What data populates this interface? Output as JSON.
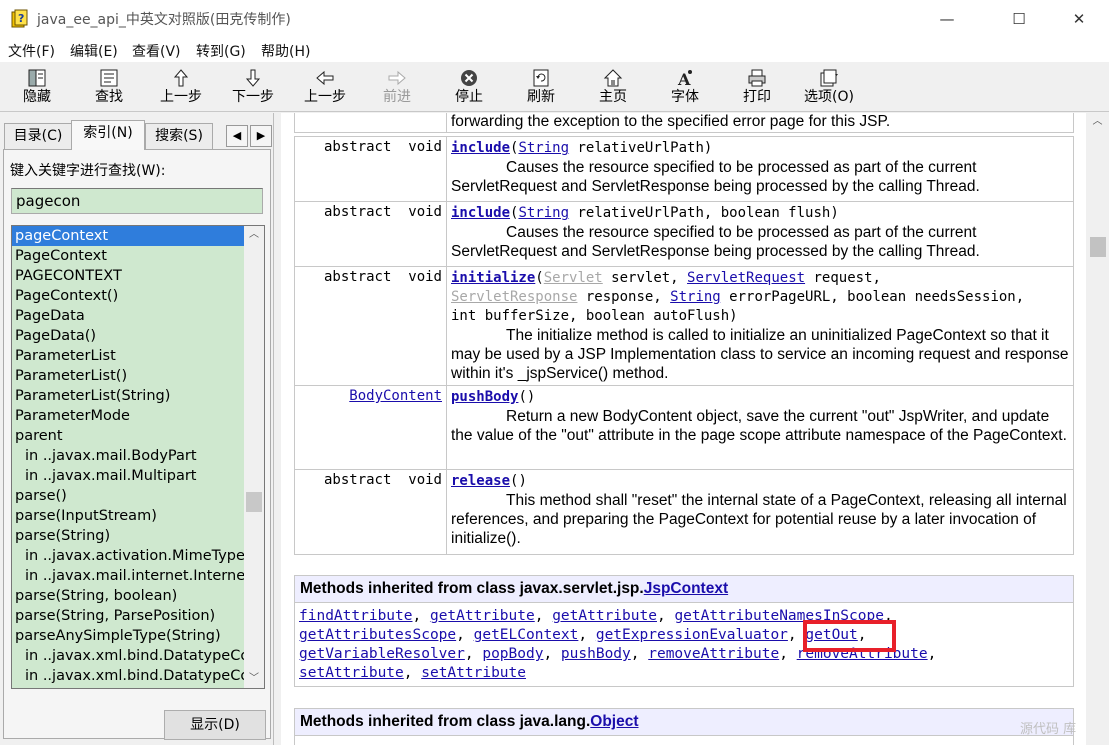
{
  "window": {
    "title": "java_ee_api_中英文对照版(田克传制作)",
    "minimize": "—",
    "maximize": "☐",
    "close": "✕"
  },
  "menu": [
    "文件(F)",
    "编辑(E)",
    "查看(V)",
    "转到(G)",
    "帮助(H)"
  ],
  "toolbar": [
    {
      "label": "隐藏",
      "icon": "hide-icon",
      "enabled": true
    },
    {
      "label": "查找",
      "icon": "find-icon",
      "enabled": true
    },
    {
      "label": "上一步",
      "icon": "up-arrow-icon",
      "enabled": true
    },
    {
      "label": "下一步",
      "icon": "down-arrow-icon",
      "enabled": true
    },
    {
      "label": "上一步",
      "icon": "back-arrow-icon",
      "enabled": true
    },
    {
      "label": "前进",
      "icon": "forward-arrow-icon",
      "enabled": false
    },
    {
      "label": "停止",
      "icon": "stop-icon",
      "enabled": true
    },
    {
      "label": "刷新",
      "icon": "refresh-icon",
      "enabled": true
    },
    {
      "label": "主页",
      "icon": "home-icon",
      "enabled": true
    },
    {
      "label": "字体",
      "icon": "font-icon",
      "enabled": true
    },
    {
      "label": "打印",
      "icon": "print-icon",
      "enabled": true
    },
    {
      "label": "选项(O)",
      "icon": "options-icon",
      "enabled": true
    }
  ],
  "tabs": [
    {
      "label": "目录(C)",
      "active": false
    },
    {
      "label": "索引(N)",
      "active": true
    },
    {
      "label": "搜索(S)",
      "active": false
    }
  ],
  "index": {
    "keyword_label": "键入关键字进行查找(W):",
    "keyword_value": "pagecon",
    "items": [
      {
        "text": "pageContext",
        "sub": false,
        "selected": true
      },
      {
        "text": "PageContext",
        "sub": false
      },
      {
        "text": "PAGECONTEXT",
        "sub": false
      },
      {
        "text": "PageContext()",
        "sub": false
      },
      {
        "text": "PageData",
        "sub": false
      },
      {
        "text": "PageData()",
        "sub": false
      },
      {
        "text": "ParameterList",
        "sub": false
      },
      {
        "text": "ParameterList()",
        "sub": false
      },
      {
        "text": "ParameterList(String)",
        "sub": false
      },
      {
        "text": "ParameterMode",
        "sub": false
      },
      {
        "text": "parent",
        "sub": false
      },
      {
        "text": "in ..javax.mail.BodyPart",
        "sub": true
      },
      {
        "text": "in ..javax.mail.Multipart",
        "sub": true
      },
      {
        "text": "parse()",
        "sub": false
      },
      {
        "text": "parse(InputStream)",
        "sub": false
      },
      {
        "text": "parse(String)",
        "sub": false
      },
      {
        "text": "in ..javax.activation.MimeType",
        "sub": true
      },
      {
        "text": "in ..javax.mail.internet.Internet",
        "sub": true
      },
      {
        "text": "parse(String, boolean)",
        "sub": false
      },
      {
        "text": "parse(String, ParsePosition)",
        "sub": false
      },
      {
        "text": "parseAnySimpleType(String)",
        "sub": false
      },
      {
        "text": "in ..javax.xml.bind.DatatypeCo",
        "sub": true
      },
      {
        "text": "in ..javax.xml.bind.DatatypeCo",
        "sub": true
      }
    ],
    "show_button": "显示(D)"
  },
  "content": {
    "top_fragment": "forwarding the exception to the specified error page for this JSP.",
    "methods": [
      {
        "type": "abstract  void",
        "name": "include",
        "sig_parts": [
          {
            "t": "(",
            "k": "text"
          },
          {
            "t": "String",
            "k": "link"
          },
          {
            "t": " relativeUrlPath)",
            "k": "text"
          }
        ],
        "desc": "Causes the resource specified to be processed as part of the current ServletRequest and ServletResponse being processed by the calling Thread."
      },
      {
        "type": "abstract  void",
        "name": "include",
        "sig_parts": [
          {
            "t": "(",
            "k": "text"
          },
          {
            "t": "String",
            "k": "link"
          },
          {
            "t": " relativeUrlPath, boolean flush)",
            "k": "text"
          }
        ],
        "desc": "Causes the resource specified to be processed as part of the current ServletRequest and ServletResponse being processed by the calling Thread."
      },
      {
        "type": "abstract  void",
        "name": "initialize",
        "sig_lines": [
          [
            {
              "t": "(",
              "k": "text"
            },
            {
              "t": "Servlet",
              "k": "dim"
            },
            {
              "t": " servlet, ",
              "k": "text"
            },
            {
              "t": "ServletRequest",
              "k": "link"
            },
            {
              "t": " request,",
              "k": "text"
            }
          ],
          [
            {
              "t": "ServletResponse",
              "k": "dim"
            },
            {
              "t": " response, ",
              "k": "text"
            },
            {
              "t": "String",
              "k": "link"
            },
            {
              "t": " errorPageURL, boolean needsSession,",
              "k": "text"
            }
          ],
          [
            {
              "t": "int bufferSize, boolean autoFlush)",
              "k": "text"
            }
          ]
        ],
        "desc": "The initialize method is called to initialize an uninitialized PageContext so that it may be used by a JSP Implementation class to service an incoming request and response within it's _jspService() method."
      },
      {
        "type": "BodyContent",
        "type_link": true,
        "name": "pushBody",
        "sig_parts": [
          {
            "t": "()",
            "k": "text"
          }
        ],
        "desc": "Return a new BodyContent object, save the current \"out\" JspWriter, and update the value of the \"out\" attribute in the page scope attribute namespace of the PageContext."
      },
      {
        "type": "abstract  void",
        "name": "release",
        "sig_parts": [
          {
            "t": "()",
            "k": "text"
          }
        ],
        "desc": "This method shall \"reset\" the internal state of a PageContext, releasing all internal references, and preparing the PageContext for potential reuse by a later invocation of initialize()."
      }
    ],
    "inherited_jsp": {
      "heading_prefix": "Methods inherited from class javax.servlet.jsp.",
      "heading_link": "JspContext",
      "lines": [
        [
          "findAttribute",
          "getAttribute",
          "getAttribute",
          "getAttributeNamesInScope"
        ],
        [
          "getAttributesScope",
          "getELContext",
          "getExpressionEvaluator",
          "getOut"
        ],
        [
          "getVariableResolver",
          "popBody",
          "pushBody",
          "removeAttribute",
          "removeAttribute"
        ],
        [
          "setAttribute",
          "setAttribute"
        ]
      ],
      "highlighted": "getOut"
    },
    "inherited_object": {
      "heading_prefix": "Methods inherited from class java.lang.",
      "heading_link": "Object"
    }
  },
  "watermark": "源代码  库"
}
